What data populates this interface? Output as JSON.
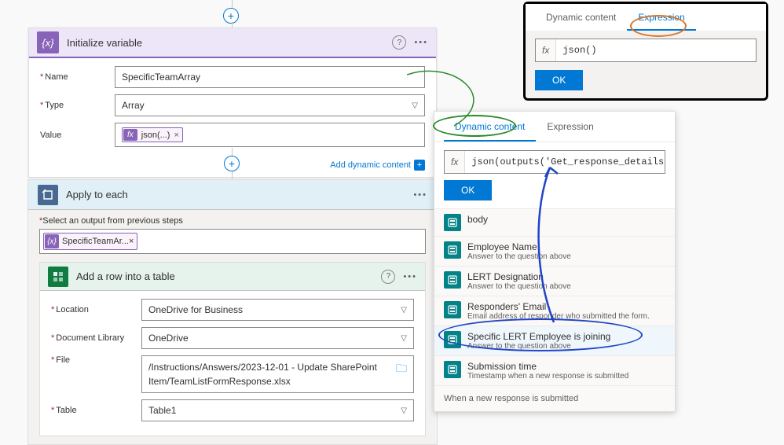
{
  "init_var": {
    "title": "Initialize variable",
    "icon_glyph": "{x}",
    "name_label": "Name",
    "name_value": "SpecificTeamArray",
    "type_label": "Type",
    "type_value": "Array",
    "value_label": "Value",
    "value_token_fx": "fx",
    "value_token_text": "json(...)",
    "add_dynamic_link": "Add dynamic content"
  },
  "apply": {
    "title": "Apply to each",
    "output_label": "Select an output from previous steps",
    "output_token": "SpecificTeamAr..."
  },
  "excel": {
    "title": "Add a row into a table",
    "location_label": "Location",
    "location_value": "OneDrive for Business",
    "doclib_label": "Document Library",
    "doclib_value": "OneDrive",
    "file_label": "File",
    "file_value": "/Instructions/Answers/2023-12-01 - Update SharePoint Item/TeamListFormResponse.xlsx",
    "table_label": "Table",
    "table_value": "Table1"
  },
  "exp_popover": {
    "tab_dynamic": "Dynamic content",
    "tab_expression": "Expression",
    "fx_label": "fx",
    "expression_text": "json()",
    "ok": "OK"
  },
  "dyn_popover": {
    "tab_dynamic": "Dynamic content",
    "tab_expression": "Expression",
    "fx_label": "fx",
    "expression_text": "json(outputs('Get_response_details')?['bod",
    "ok": "OK",
    "items": [
      {
        "title": "body",
        "sub": ""
      },
      {
        "title": "Employee Name",
        "sub": "Answer to the question above"
      },
      {
        "title": "LERT Designation",
        "sub": "Answer to the question above"
      },
      {
        "title": "Responders' Email",
        "sub": "Email address of responder who submitted the form."
      },
      {
        "title": "Specific LERT Employee is joining",
        "sub": "Answer to the question above"
      },
      {
        "title": "Submission time",
        "sub": "Timestamp when a new response is submitted"
      }
    ],
    "group_footer": "When a new response is submitted"
  }
}
